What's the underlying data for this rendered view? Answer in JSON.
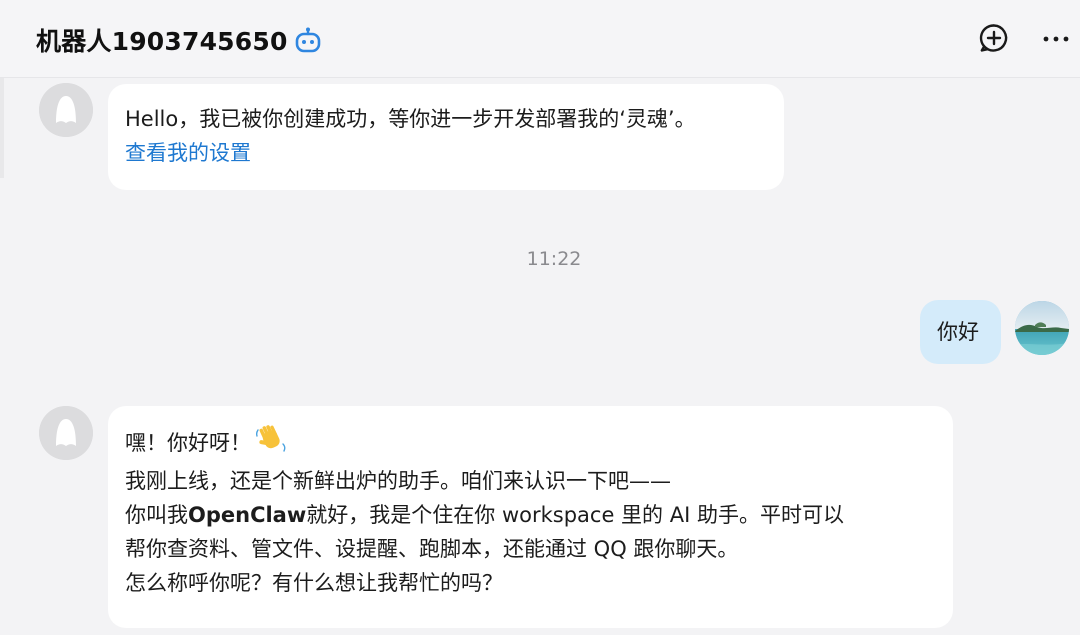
{
  "header": {
    "title": "机器人1903745650",
    "bot_badge_icon": "robot-icon",
    "add_icon": "add-circle-icon",
    "more_icon": "more-horizontal-icon"
  },
  "messages": [
    {
      "sender": "bot",
      "avatar_icon": "default-avatar-icon",
      "text": "Hello，我已被你创建成功，等你进一步开发部署我的‘灵魂’。",
      "link": "查看我的设置"
    },
    {
      "type": "timestamp",
      "text": "11:22"
    },
    {
      "sender": "user",
      "avatar_icon": "landscape-avatar",
      "text": "你好"
    },
    {
      "sender": "bot",
      "avatar_icon": "default-avatar-icon",
      "line1": "嘿！你好呀！",
      "emoji": "👋",
      "line2": "我刚上线，还是个新鲜出炉的助手。咱们来认识一下吧——",
      "line3_prefix": "你叫我",
      "line3_bold": "OpenClaw",
      "line3_suffix": "就好，我是个住在你 workspace 里的 AI 助手。平时可以",
      "line4": "帮你查资料、管文件、设提醒、跑脚本，还能通过 QQ 跟你聊天。",
      "line5": "怎么称呼你呢？有什么想让我帮忙的吗？"
    }
  ],
  "colors": {
    "accent_link": "#1e78d0",
    "user_bubble": "#d4ebfa",
    "bot_badge": "#2f86e0"
  }
}
